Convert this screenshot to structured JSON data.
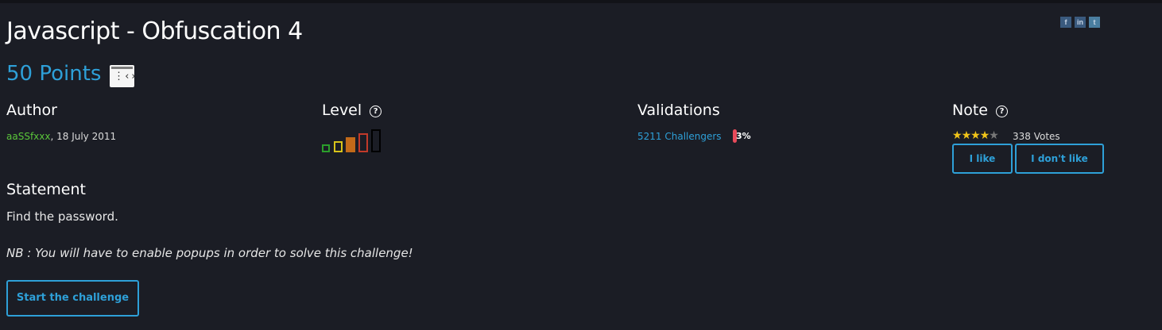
{
  "share": {
    "facebook": "f",
    "linkedin": "in",
    "twitter": "t"
  },
  "challenge": {
    "title": "Javascript - Obfuscation 4",
    "points": "50 Points",
    "category_icon": "code-window-icon"
  },
  "author": {
    "heading": "Author",
    "name": "aaSSfxxx",
    "date": ", 18 July 2011"
  },
  "level": {
    "heading": "Level",
    "help_icon": "?",
    "current": 3,
    "max": 5
  },
  "validations": {
    "heading": "Validations",
    "challengers": "5211 Challengers",
    "percent": "3%",
    "percent_value": 3
  },
  "note": {
    "heading": "Note",
    "help_icon": "?",
    "stars_filled": 4,
    "stars_total": 5,
    "votes": "338 Votes",
    "like_label": "I like",
    "dislike_label": "I don't like"
  },
  "statement": {
    "heading": "Statement",
    "text": "Find the password.",
    "nb": "NB : You will have to enable popups in order to solve this challenge!"
  },
  "start_button": "Start the challenge",
  "colors": {
    "background": "#1b1d25",
    "accent": "#2ea0d8",
    "author_green": "#5ac63a",
    "star": "#f0c419",
    "percent_bar": "#e84a5a"
  }
}
